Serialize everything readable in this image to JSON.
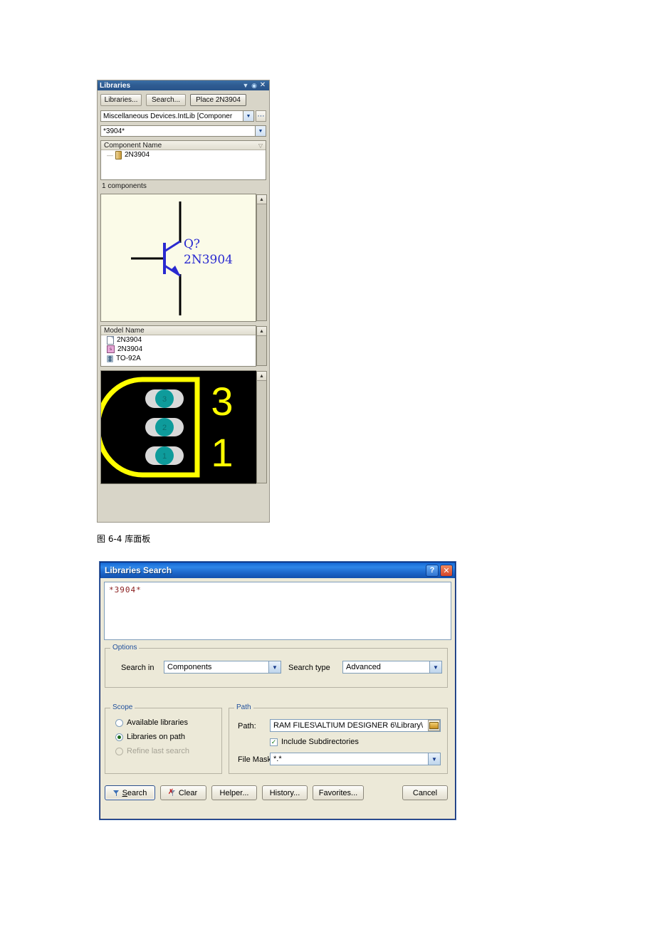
{
  "libraries_panel": {
    "title": "Libraries",
    "title_buttons": [
      {
        "name": "dropdown-icon",
        "glyph": "▼"
      },
      {
        "name": "pin-icon",
        "glyph": "◉"
      },
      {
        "name": "close-icon",
        "glyph": "✕"
      }
    ],
    "buttons": {
      "libraries": "Libraries...",
      "search": "Search...",
      "place": "Place 2N3904"
    },
    "library_select": {
      "value": "Miscellaneous Devices.IntLib [Componer",
      "ellipsis_label": "…"
    },
    "filter": {
      "value": "*3904*"
    },
    "component_list": {
      "header": "Component Name",
      "sort_glyph": "▽",
      "items": [
        {
          "label": "2N3904",
          "icon": "component-icon"
        }
      ]
    },
    "count_label": "1 components",
    "symbol_preview": {
      "designator": "Q?",
      "part_name": "2N3904",
      "symbol_color": "#2a2ad0",
      "background": "#fbfbe8"
    },
    "model_list": {
      "header": "Model Name",
      "items": [
        {
          "label": "2N3904",
          "icon": "signal-integrity-model-icon"
        },
        {
          "label": "2N3904",
          "icon": "simulation-model-icon"
        },
        {
          "label": "TO-92A",
          "icon": "pcb-footprint-icon"
        }
      ]
    },
    "footprint_preview": {
      "background": "#000000",
      "outline_color": "#ffff00",
      "pad_color": "#d9d9d9",
      "hole_color": "#0e9b9b",
      "pads": [
        "3",
        "2",
        "1"
      ],
      "designator_digits": [
        "3",
        "1"
      ]
    }
  },
  "figure_caption": "图 6-4 库面板",
  "search_dialog": {
    "title": "Libraries Search",
    "title_buttons": [
      {
        "name": "help-button",
        "glyph": "?"
      },
      {
        "name": "close-button",
        "glyph": "✕"
      }
    ],
    "query_text": "*3904*",
    "options": {
      "legend": "Options",
      "search_in_label": "Search in",
      "search_in_value": "Components",
      "search_type_label": "Search type",
      "search_type_value": "Advanced"
    },
    "scope": {
      "legend": "Scope",
      "items": [
        {
          "label": "Available libraries",
          "selected": false,
          "disabled": false
        },
        {
          "label": "Libraries on path",
          "selected": true,
          "disabled": false
        },
        {
          "label": "Refine last search",
          "selected": false,
          "disabled": true
        }
      ]
    },
    "path": {
      "legend": "Path",
      "path_label": "Path:",
      "path_value": "RAM FILES\\ALTIUM DESIGNER 6\\Library\\",
      "include_subdirs_label": "Include Subdirectories",
      "include_subdirs_checked": true,
      "check_glyph": "✓",
      "file_mask_label": "File Mask:",
      "file_mask_value": "*.*"
    },
    "buttons": {
      "search": "Search",
      "search_accel": "S",
      "clear": "Clear",
      "helper": "Helper...",
      "history": "History...",
      "favorites": "Favorites...",
      "cancel": "Cancel"
    }
  }
}
